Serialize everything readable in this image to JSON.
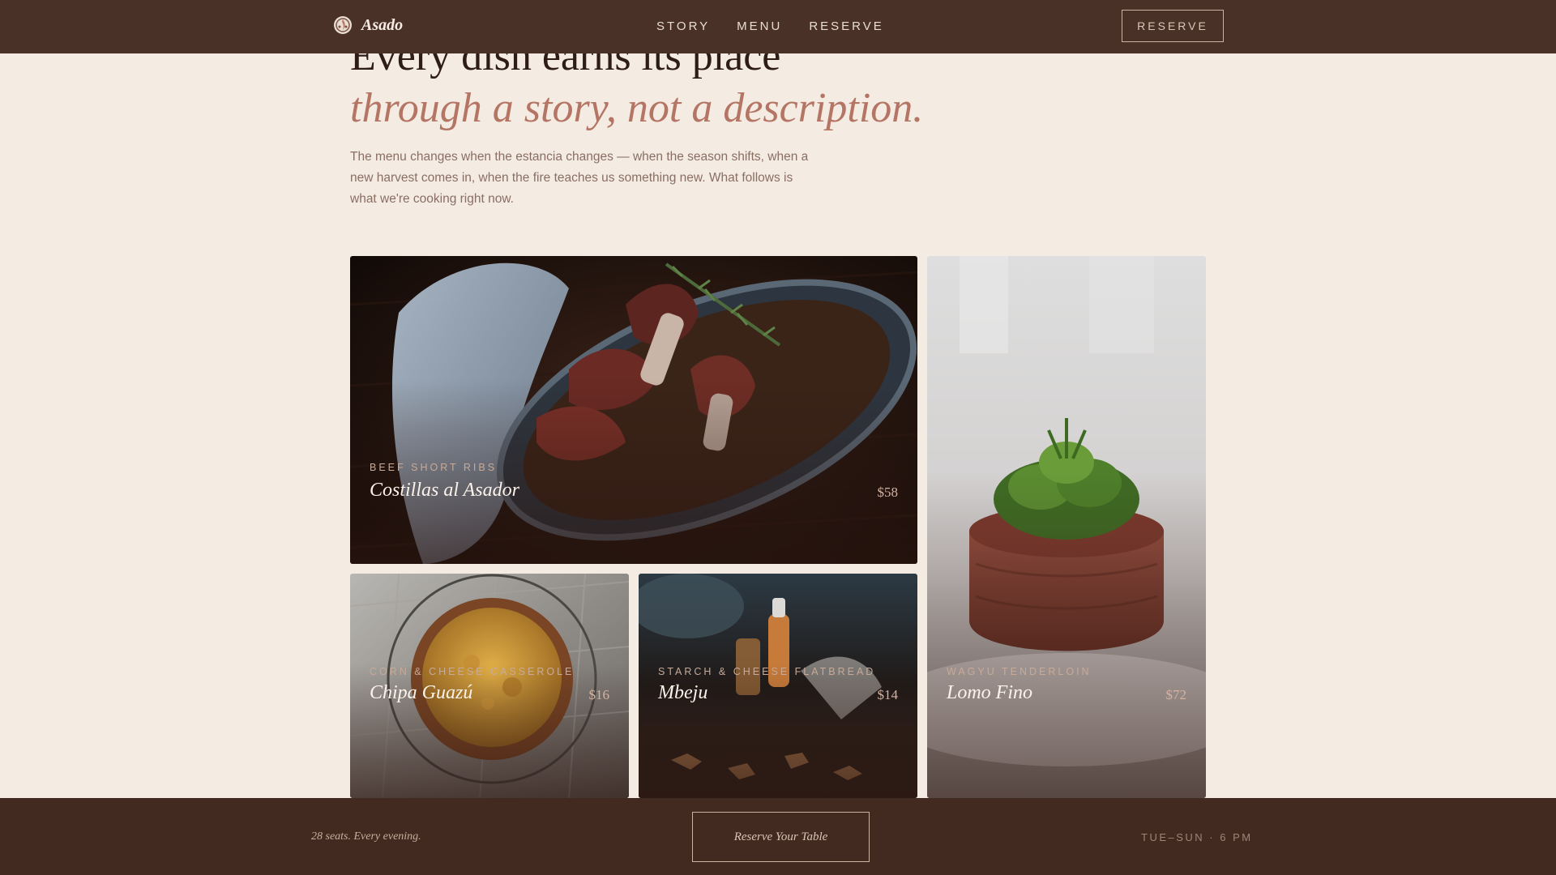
{
  "header": {
    "brand_name": "Asado",
    "logo_icon": "flame-seal-icon",
    "nav": [
      {
        "label": "STORY"
      },
      {
        "label": "MENU"
      },
      {
        "label": "RESERVE"
      }
    ],
    "cta_label": "RESERVE"
  },
  "hero": {
    "title": "Every dish earns its place",
    "subtitle": "through a story, not a description.",
    "description": "The menu changes when the estancia changes — when the season shifts, when a new harvest comes in, when the fire teaches us something new. What follows is what we're cooking right now."
  },
  "dishes": [
    {
      "kicker": "BEEF SHORT RIBS",
      "name": "Costillas al Asador",
      "price": "$58"
    },
    {
      "kicker": "CORN & CHEESE CASSEROLE",
      "name": "Chipa Guazú",
      "price": "$16"
    },
    {
      "kicker": "STARCH & CHEESE FLATBREAD",
      "name": "Mbeju",
      "price": "$14"
    },
    {
      "kicker": "WAGYU TENDERLOIN",
      "name": "Lomo Fino",
      "price": "$72"
    }
  ],
  "footer": {
    "tagline": "28 seats. Every evening.",
    "cta_label": "Reserve Your Table",
    "hours": "TUE–SUN · 6 PM"
  },
  "colors": {
    "header_bg": "#4a3128",
    "page_bg": "#f4ebe2",
    "accent": "#b57565",
    "footer_bg": "#432a21"
  }
}
